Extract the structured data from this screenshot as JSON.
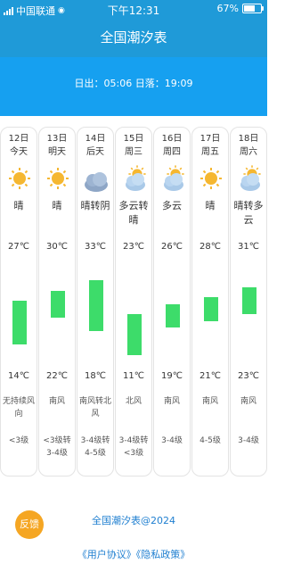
{
  "status_bar": {
    "carrier": "中国联通",
    "time": "下午12:31",
    "battery": "67%",
    "battery_level": 0.67
  },
  "header": {
    "title": "全国潮汐表"
  },
  "sun": {
    "text": "日出：05:06 日落：19:09"
  },
  "forecast": [
    {
      "date": "12日",
      "day": "今天",
      "icon": "sunny-icon",
      "condition": "晴",
      "high": "27℃",
      "low": "14℃",
      "high_value": 27,
      "low_value": 14,
      "wind": "无持续风向",
      "level": "<3级"
    },
    {
      "date": "13日",
      "day": "明天",
      "icon": "sunny-icon",
      "condition": "晴",
      "high": "30℃",
      "low": "22℃",
      "high_value": 30,
      "low_value": 22,
      "wind": "南风",
      "level": "<3级转3-4级"
    },
    {
      "date": "14日",
      "day": "后天",
      "icon": "cloudy-icon",
      "condition": "晴转阴",
      "high": "33℃",
      "low": "18℃",
      "high_value": 33,
      "low_value": 18,
      "wind": "南风转北风",
      "level": "3-4级转4-5级"
    },
    {
      "date": "15日",
      "day": "周三",
      "icon": "partly-cloudy-icon",
      "condition": "多云转晴",
      "high": "23℃",
      "low": "11℃",
      "high_value": 23,
      "low_value": 11,
      "wind": "北风",
      "level": "3-4级转<3级"
    },
    {
      "date": "16日",
      "day": "周四",
      "icon": "partly-cloudy-icon",
      "condition": "多云",
      "high": "26℃",
      "low": "19℃",
      "high_value": 26,
      "low_value": 19,
      "wind": "南风",
      "level": "3-4级"
    },
    {
      "date": "17日",
      "day": "周五",
      "icon": "sunny-icon",
      "condition": "晴",
      "high": "28℃",
      "low": "21℃",
      "high_value": 28,
      "low_value": 21,
      "wind": "南风",
      "level": "4-5级"
    },
    {
      "date": "18日",
      "day": "周六",
      "icon": "partly-cloudy-icon",
      "condition": "晴转多云",
      "high": "31℃",
      "low": "23℃",
      "high_value": 31,
      "low_value": 23,
      "wind": "南风",
      "level": "3-4级"
    }
  ],
  "footer": {
    "brand": "全国潮汐表@2024",
    "links": "《用户协议》《隐私政策》",
    "feedback_label": "反馈"
  },
  "colors": {
    "header": "#1f9ad8",
    "sun_bar": "#16a0f0",
    "bar": "#3ddc6a",
    "sun": "#f5b731",
    "cloud": "#a9c9e8",
    "link": "#1f7fd0",
    "feedback": "#f5a623"
  }
}
